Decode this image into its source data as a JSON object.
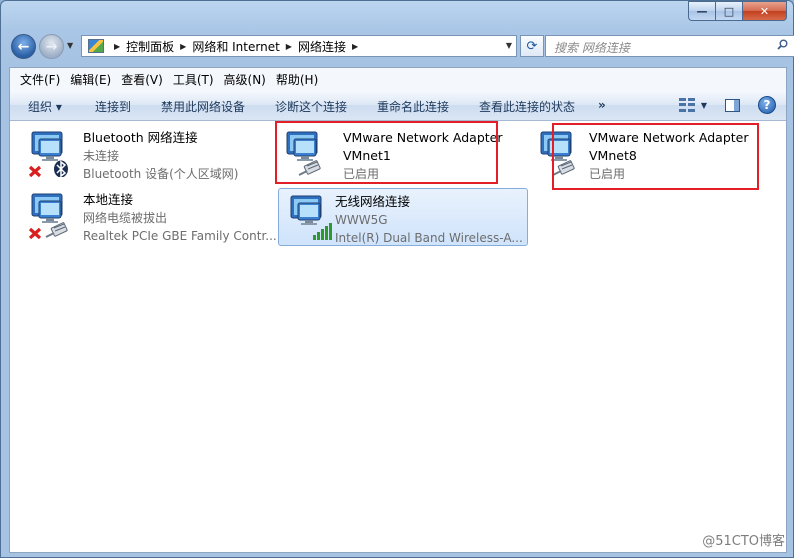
{
  "window": {
    "caption": {
      "min": "—",
      "max": "□",
      "close": "✕"
    }
  },
  "nav": {
    "back_glyph": "←",
    "forward_glyph": "→",
    "breadcrumbs": [
      "控制面板",
      "网络和 Internet",
      "网络连接"
    ],
    "search_placeholder": "搜索 网络连接"
  },
  "menu": [
    "文件(F)",
    "编辑(E)",
    "查看(V)",
    "工具(T)",
    "高级(N)",
    "帮助(H)"
  ],
  "toolbar": {
    "organize": "组织 ▾",
    "connect_to": "连接到",
    "disable": "禁用此网络设备",
    "diagnose": "诊断这个连接",
    "rename": "重命名此连接",
    "view_status": "查看此连接的状态",
    "more": "»",
    "help": "?"
  },
  "connections": [
    {
      "name": "Bluetooth 网络连接",
      "status": "未连接",
      "device": "Bluetooth 设备(个人区域网)",
      "badge": "bluetooth",
      "error": true,
      "selected": false
    },
    {
      "name": "VMware Network Adapter",
      "status": "VMnet1",
      "device": "已启用",
      "badge": "cable",
      "error": false,
      "selected": false
    },
    {
      "name": "VMware Network Adapter",
      "status": "VMnet8",
      "device": "已启用",
      "badge": "cable",
      "error": false,
      "selected": false
    },
    {
      "name": "本地连接",
      "status": "网络电缆被拔出",
      "device": "Realtek PCIe GBE Family Contr...",
      "badge": "cable",
      "error": true,
      "selected": false
    },
    {
      "name": "无线网络连接",
      "status": "WWW5G",
      "device": "Intel(R) Dual Band Wireless-A...",
      "badge": "signal",
      "error": false,
      "selected": true
    }
  ],
  "colors": {
    "highlight": "#e21f26",
    "selection": "#cfe3fb"
  },
  "watermark": "@51CTO博客"
}
